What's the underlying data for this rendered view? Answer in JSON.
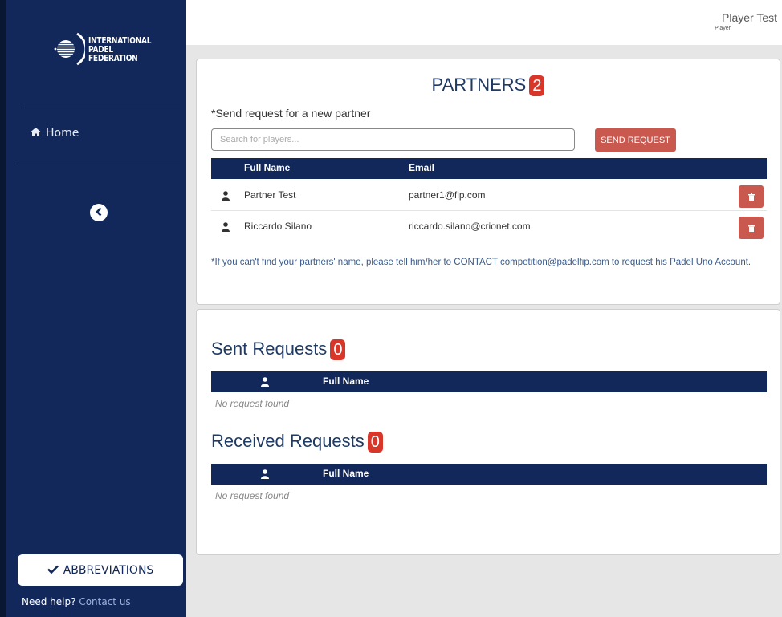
{
  "brand": {
    "line1": "INTERNATIONAL",
    "line2": "PADEL",
    "line3": "FEDERATION"
  },
  "sidebar": {
    "home_label": "Home",
    "abbreviations_label": "ABBREVIATIONS",
    "help_text": "Need help?",
    "contact_link": "Contact us"
  },
  "header": {
    "user_name": "Player Test",
    "user_role": "Player"
  },
  "partners": {
    "title": "PARTNERS",
    "count": "2",
    "send_label": "*Send request for a new partner",
    "search_placeholder": "Search for players...",
    "send_button": "SEND REQUEST",
    "columns": {
      "full_name": "Full Name",
      "email": "Email"
    },
    "rows": [
      {
        "name": "Partner Test",
        "email": "partner1@fip.com"
      },
      {
        "name": "Riccardo Silano",
        "email": "riccardo.silano@crionet.com"
      }
    ],
    "note": "*If you can't find your partners' name, please tell him/her to CONTACT competition@padelfip.com to request his Padel Uno Account."
  },
  "sent": {
    "title": "Sent Requests",
    "count": "0",
    "column": "Full Name",
    "empty": "No request found"
  },
  "received": {
    "title": "Received Requests",
    "count": "0",
    "column": "Full Name",
    "empty": "No request found"
  },
  "colors": {
    "navy": "#12285b",
    "accent_red": "#d9362a",
    "button_red": "#c9584f"
  },
  "icons": [
    "home-icon",
    "chevron-left-icon",
    "check-icon",
    "user-icon",
    "trash-icon"
  ]
}
